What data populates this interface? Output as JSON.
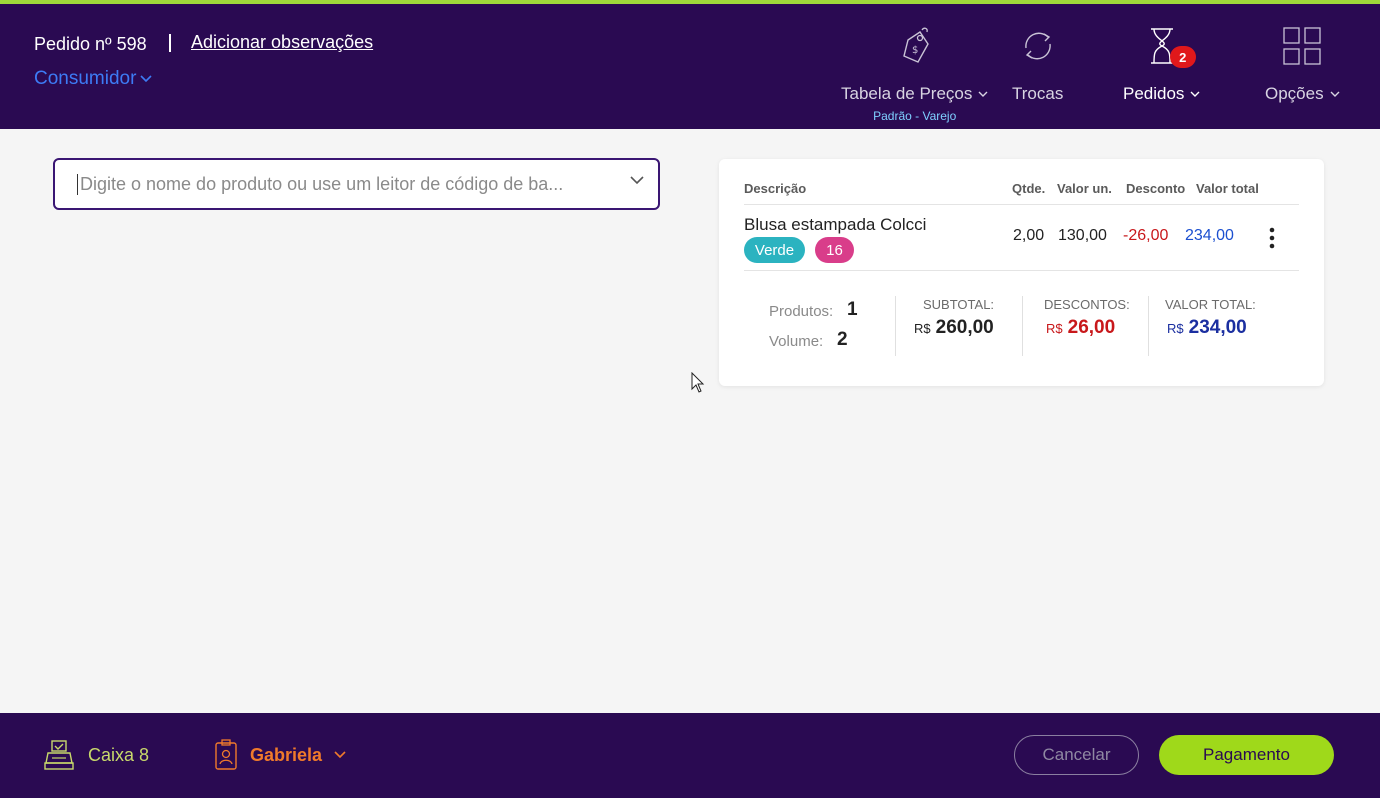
{
  "header": {
    "order_label": "Pedido nº 598",
    "obs_link": "Adicionar observações",
    "consumer": "Consumidor",
    "nav": {
      "price_table": "Tabela de Preços",
      "price_table_sub": "Padrão - Varejo",
      "exchanges": "Trocas",
      "orders": "Pedidos",
      "orders_badge": "2",
      "options": "Opções"
    }
  },
  "search": {
    "placeholder": "Digite o nome do produto ou use um leitor de código de ba...",
    "value": ""
  },
  "cart": {
    "columns": [
      "Descrição",
      "Qtde.",
      "Valor un.",
      "Desconto",
      "Valor total"
    ],
    "items": [
      {
        "name": "Blusa estampada Colcci",
        "color_tag": "Verde",
        "size_tag": "16",
        "qty": "2,00",
        "unit_price": "130,00",
        "discount": "-26,00",
        "total": "234,00"
      }
    ],
    "summary": {
      "products_label": "Produtos:",
      "products_value": "1",
      "volume_label": "Volume:",
      "volume_value": "2",
      "subtotal_label": "SUBTOTAL:",
      "subtotal_currency": "R$",
      "subtotal_value": "260,00",
      "discounts_label": "DESCONTOS:",
      "discounts_currency": "R$",
      "discounts_value": "26,00",
      "total_label": "VALOR TOTAL:",
      "total_currency": "R$",
      "total_value": "234,00"
    }
  },
  "footer": {
    "register": "Caixa 8",
    "user": "Gabriela",
    "cancel": "Cancelar",
    "payment": "Pagamento"
  },
  "colors": {
    "brand_dark": "#2a0a52",
    "accent_green": "#9fd91a",
    "tag_green": "#2bb3c0",
    "tag_pink": "#d93d8a",
    "discount_red": "#c8181b",
    "total_blue": "#1b4fd0"
  }
}
